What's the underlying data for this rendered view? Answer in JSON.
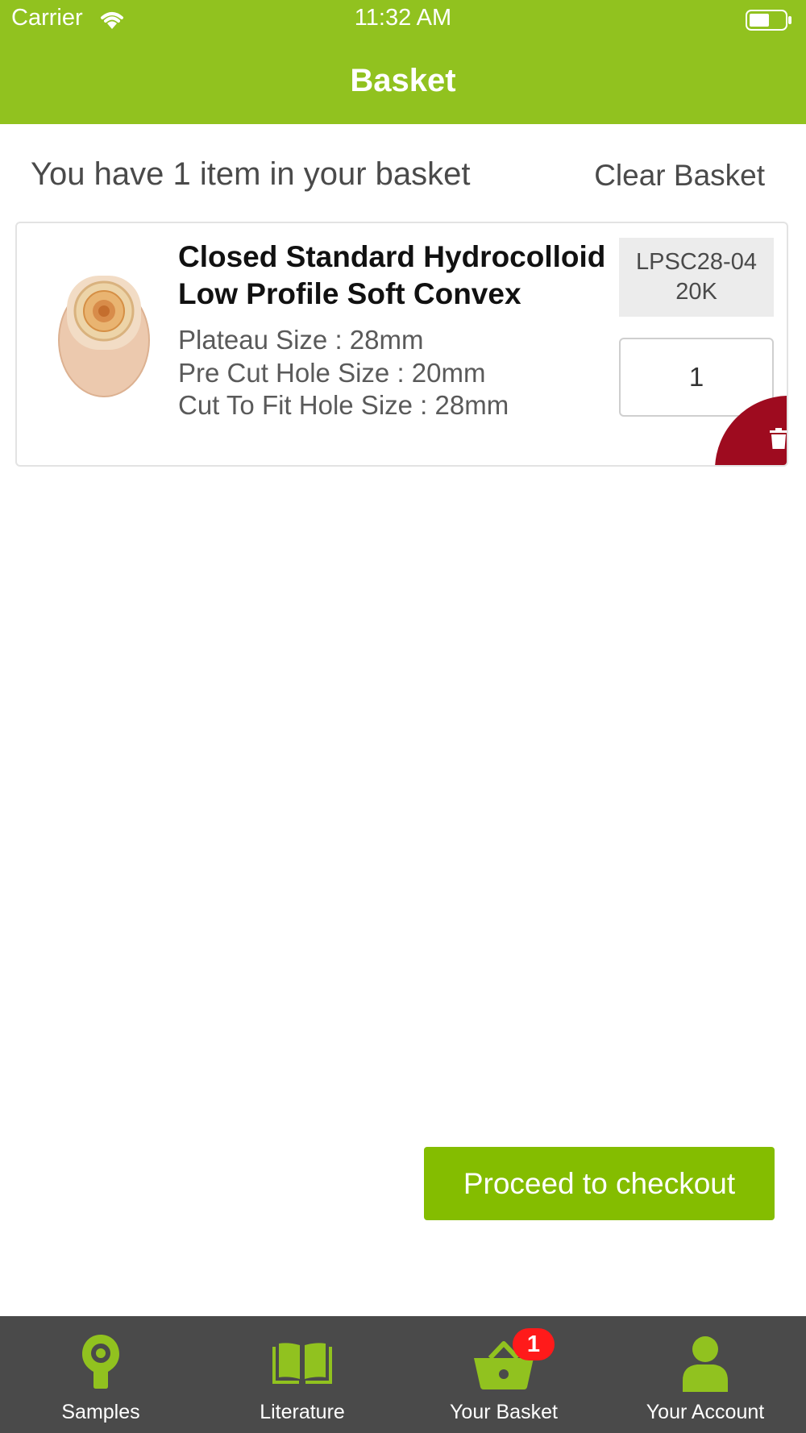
{
  "status_bar": {
    "carrier": "Carrier",
    "time": "11:32 AM"
  },
  "header": {
    "title": "Basket"
  },
  "summary": {
    "text": "You have 1 item in your basket",
    "clear_label": "Clear Basket"
  },
  "item": {
    "title_line1": "Closed Standard Hydrocolloid",
    "title_line2": "Low Profile Soft Convex",
    "specs": [
      "Plateau Size : 28mm",
      "Pre Cut Hole Size : 20mm",
      "Cut To Fit Hole Size : 28mm"
    ],
    "sku_line1": "LPSC28-04",
    "sku_line2": "20K",
    "quantity": "1"
  },
  "checkout": {
    "label": "Proceed to checkout"
  },
  "tabs": [
    {
      "label": "Samples",
      "icon": "samples-icon"
    },
    {
      "label": "Literature",
      "icon": "book-icon"
    },
    {
      "label": "Your Basket",
      "icon": "basket-icon",
      "badge": "1"
    },
    {
      "label": "Your Account",
      "icon": "user-icon"
    }
  ],
  "colors": {
    "brand_green": "#91c21f",
    "button_green": "#84bd00",
    "delete_red": "#9e0b1f",
    "tabbar_bg": "#4a4a4a",
    "badge_red": "#ff1a1a"
  }
}
